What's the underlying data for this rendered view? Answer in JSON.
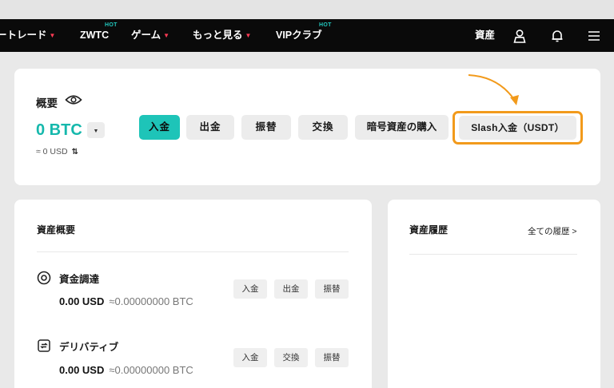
{
  "navbar": {
    "items": [
      {
        "label": "ートレード",
        "dropdown": true,
        "hot": ""
      },
      {
        "label": "ZWTC",
        "dropdown": false,
        "hot": "HOT"
      },
      {
        "label": "ゲーム",
        "dropdown": true,
        "hot": ""
      },
      {
        "label": "もっと見る",
        "dropdown": true,
        "hot": ""
      },
      {
        "label": "VIPクラブ",
        "dropdown": false,
        "hot": "HOT"
      }
    ],
    "caret": "▼",
    "right_label": "資産",
    "icons": [
      "user-icon",
      "bell-icon",
      "menu-icon"
    ]
  },
  "overview": {
    "title": "概要",
    "balance": "0 BTC",
    "dropdown_glyph": "▼",
    "usd": "≈ 0 USD",
    "swap_glyph": "⇅",
    "buttons": {
      "deposit": "入金",
      "withdraw": "出金",
      "transfer": "振替",
      "exchange": "交換",
      "buy_crypto": "暗号資産の購入",
      "slash_deposit": "Slash入金（USDT）"
    },
    "highlight_color": "#f29a1b",
    "accent_color": "#1ec4b8"
  },
  "assets": {
    "title": "資産概要",
    "accounts": [
      {
        "name": "資金調達",
        "icon": "funding-icon",
        "usd": "0.00 USD",
        "btc": "≈0.00000000 BTC",
        "actions": [
          "入金",
          "出金",
          "振替"
        ]
      },
      {
        "name": "デリバティブ",
        "icon": "derivatives-icon",
        "usd": "0.00 USD",
        "btc": "≈0.00000000 BTC",
        "actions": [
          "入金",
          "交換",
          "振替"
        ]
      }
    ]
  },
  "history": {
    "title": "資産履歴",
    "link": "全ての履歴 >"
  }
}
